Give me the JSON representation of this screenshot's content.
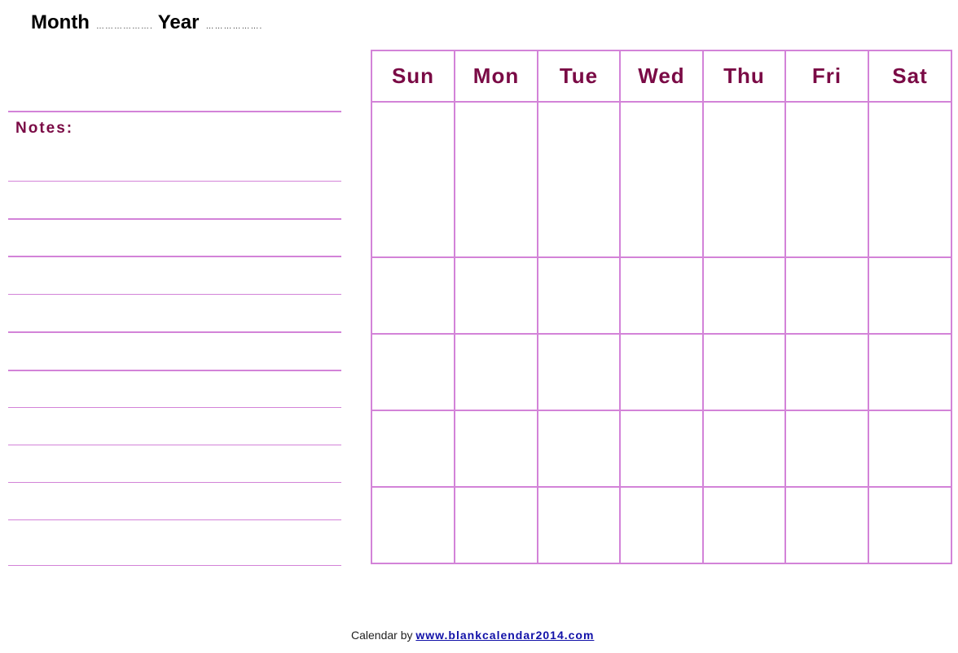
{
  "header": {
    "month_label": "Month",
    "month_blank": "……………….",
    "year_label": "Year",
    "year_blank": "………………."
  },
  "notes": {
    "label": "Notes:",
    "line_count": 12
  },
  "calendar": {
    "days": [
      "Sun",
      "Mon",
      "Tue",
      "Wed",
      "Thu",
      "Fri",
      "Sat"
    ],
    "week_rows": 5
  },
  "footer": {
    "prefix": "Calendar by",
    "link_text": "www.blankcalendar2014.com"
  },
  "colors": {
    "line": "#d383d8",
    "heading": "#7a0a45",
    "link": "#1010a8"
  }
}
